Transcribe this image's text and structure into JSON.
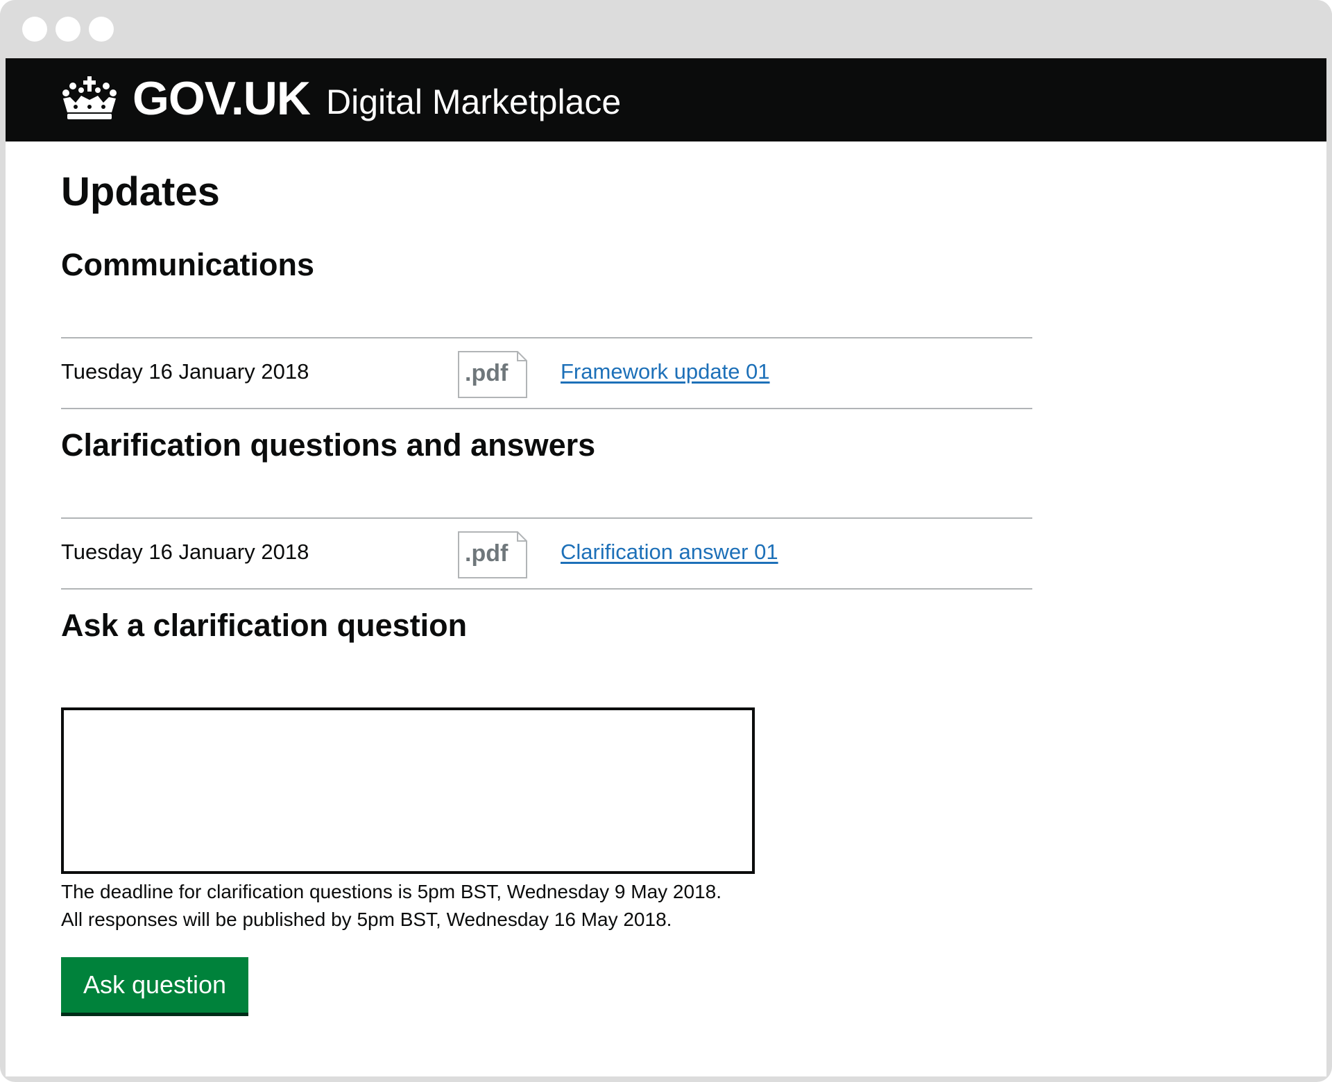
{
  "header": {
    "logo_text": "GOV.UK",
    "service_name": "Digital Marketplace"
  },
  "page": {
    "title": "Updates"
  },
  "communications": {
    "heading": "Communications",
    "items": [
      {
        "date": "Tuesday 16 January 2018",
        "file_type": ".pdf",
        "link_text": "Framework update 01"
      }
    ]
  },
  "clarifications": {
    "heading": "Clarification questions and answers",
    "items": [
      {
        "date": "Tuesday 16 January 2018",
        "file_type": ".pdf",
        "link_text": "Clarification answer 01"
      }
    ]
  },
  "ask": {
    "heading": "Ask a clarification question",
    "input_value": "",
    "hint_line_1": "The deadline for clarification questions is 5pm BST, Wednesday 9 May 2018.",
    "hint_line_2": "All responses will be published by 5pm BST, Wednesday 16 May 2018.",
    "button_label": "Ask question"
  },
  "colors": {
    "header_bg": "#0b0c0c",
    "link": "#1d70b8",
    "button_bg": "#00823b",
    "border": "#b1b4b6"
  },
  "icons": {
    "window_controls": [
      "window-dot-icon",
      "window-dot-icon",
      "window-dot-icon"
    ],
    "logo": "crown-icon",
    "file": "pdf-file-icon"
  }
}
